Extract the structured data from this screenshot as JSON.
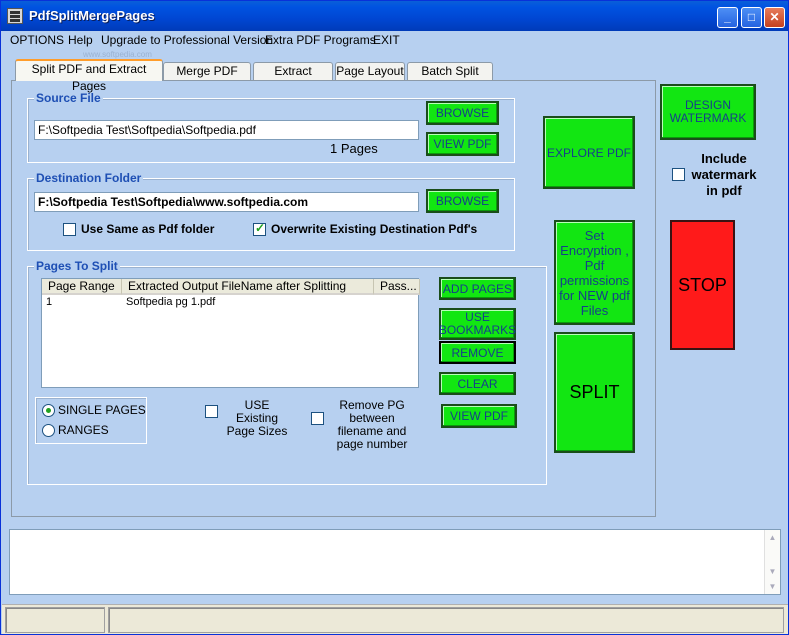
{
  "window": {
    "title": "PdfSplitMergePages"
  },
  "titlebar_buttons": {
    "minimize": "_",
    "maximize": "□",
    "close": "✕"
  },
  "menu": [
    "OPTIONS",
    "Help",
    "Upgrade to Professional Version",
    "Extra PDF Programs",
    "EXIT"
  ],
  "menu_watermark": "www.softpedia.com",
  "tabs": [
    "Split PDF and Extract Pages",
    "Merge PDF Files",
    "Extract Images",
    "Page Layout",
    "Batch Split PDF"
  ],
  "source": {
    "title": "Source File",
    "path": "F:\\Softpedia Test\\Softpedia\\Softpedia.pdf",
    "pages": "1 Pages",
    "browse": "BROWSE",
    "view": "VIEW PDF"
  },
  "destination": {
    "title": "Destination Folder",
    "path": "F:\\Softpedia Test\\Softpedia\\www.softpedia.com",
    "browse": "BROWSE",
    "same_folder": "Use Same as Pdf folder",
    "overwrite": "Overwrite Existing Destination Pdf's"
  },
  "pages_group": {
    "title": "Pages To Split",
    "columns": [
      "Page Range",
      "Extracted Output FileName after Splitting",
      "Pass..."
    ],
    "rows": [
      {
        "range": "1",
        "filename": "Softpedia pg 1.pdf",
        "pass": ""
      }
    ],
    "single_pages": "SINGLE PAGES",
    "ranges": "RANGES",
    "use_existing": "USE Existing Page Sizes",
    "remove_pg": "Remove PG between filename and page number",
    "add_pages": "ADD PAGES",
    "use_bookmarks": "USE BOOKMARKS",
    "remove": "REMOVE",
    "clear": "CLEAR",
    "view_pdf": "VIEW PDF"
  },
  "right": {
    "explore_pdf": "EXPLORE PDF",
    "encryption": "Set Encryption , Pdf permissions for NEW pdf Files",
    "split": "SPLIT",
    "design_watermark": "DESIGN WATERMARK",
    "include_watermark": "Include watermark in pdf",
    "stop": "STOP"
  },
  "colors": {
    "green": "#12e612",
    "stop_red": "#ff1a1a",
    "panel": "#b7d0f0",
    "titlebar": "#0053e1"
  }
}
